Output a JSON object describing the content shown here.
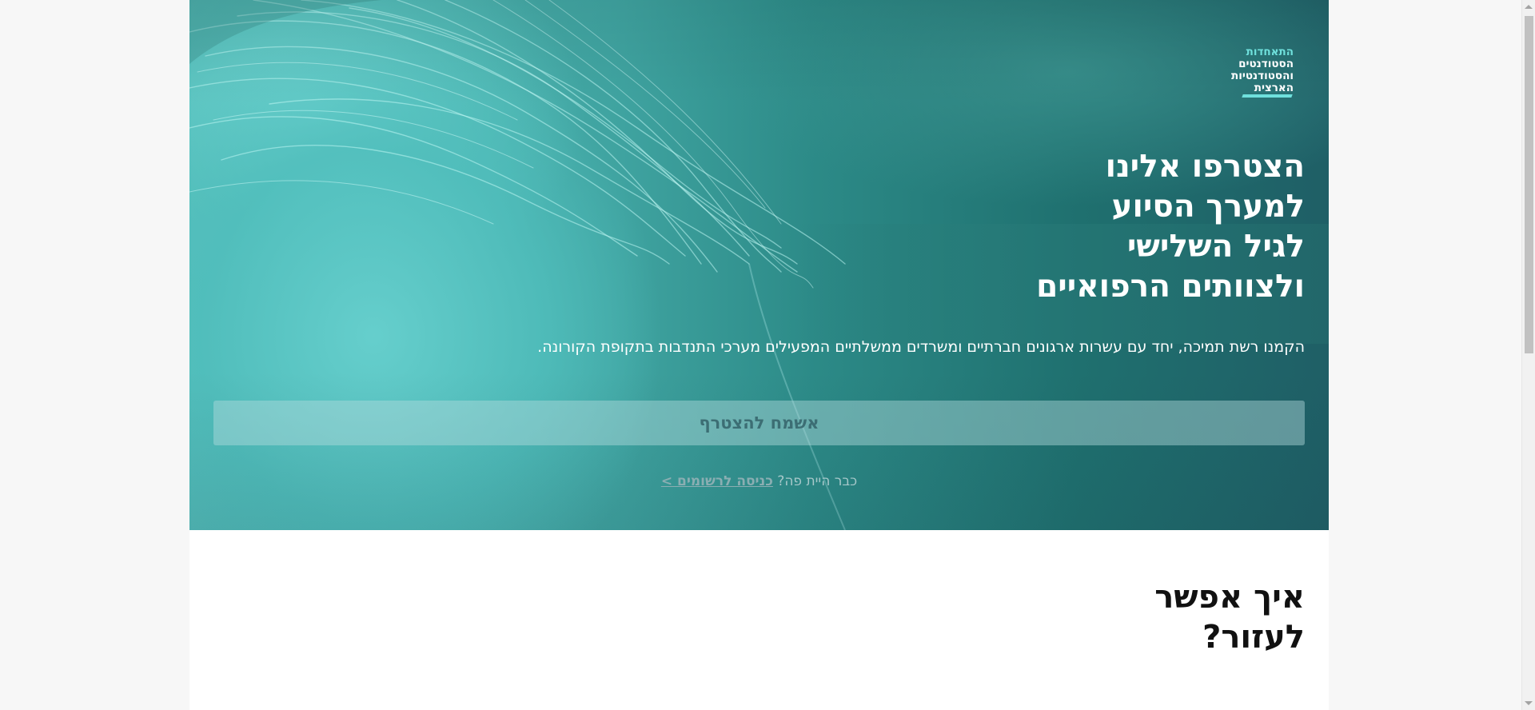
{
  "logo": {
    "lines": [
      "התאחדות",
      "הסטודנטים",
      "והסטודנטיות",
      "הארצית"
    ]
  },
  "hero": {
    "title_lines": [
      "הצטרפו אלינו",
      "למערך הסיוע",
      "לגיל השלישי",
      "ולצוותים הרפואיים"
    ],
    "subtitle": "הקמנו רשת תמיכה, יחד עם עשרות ארגונים חברתיים ומשרדים ממשלתיים המפעילים מערכי התנדבות בתקופת הקורונה.",
    "join_button_label": "אשמח להצטרף",
    "already_here_text": "כבר היית פה?",
    "login_link_label": "כניסה לרשומים >"
  },
  "section": {
    "title_lines": [
      "איך אפשר",
      "לעזור?"
    ]
  },
  "colors": {
    "accent": "#6fe0dc",
    "hero_dark": "#1f5f66",
    "hero_light": "#54bcb9"
  }
}
